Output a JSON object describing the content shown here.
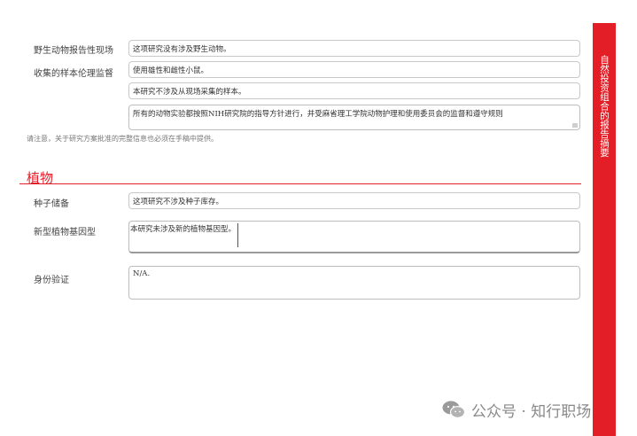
{
  "rows": {
    "wildlife": {
      "label": "野生动物报告性现场",
      "value": "这项研究没有涉及野生动物。"
    },
    "ethics": {
      "label": "收集的样本伦理监督",
      "value": "使用雄性和雌性小鼠。"
    },
    "field_samples": {
      "value": "本研究不涉及从现场采集的样本。"
    },
    "animal_exp": {
      "value": "所有的动物实验都按照NIH研究院的指导方针进行，并受麻省理工学院动物护理和使用委员会的监督和遵守规则"
    }
  },
  "note": "请注意，关于研究方案批准的完整信息也必须在手稿中提供。",
  "plants_section": {
    "title": "植物",
    "seed": {
      "label": "种子储备",
      "value": "这项研究不涉及种子库存。"
    },
    "genotype": {
      "label": "新型植物基因型",
      "value": "本研究未涉及新的植物基因型。"
    },
    "authentication": {
      "label": "身份验证",
      "value": "N/A."
    }
  },
  "sidebar": {
    "text": "自然投资组合的报告摘要"
  },
  "watermark": {
    "text": "公众号 · 知行职场",
    "icon": "wechat-icon"
  }
}
